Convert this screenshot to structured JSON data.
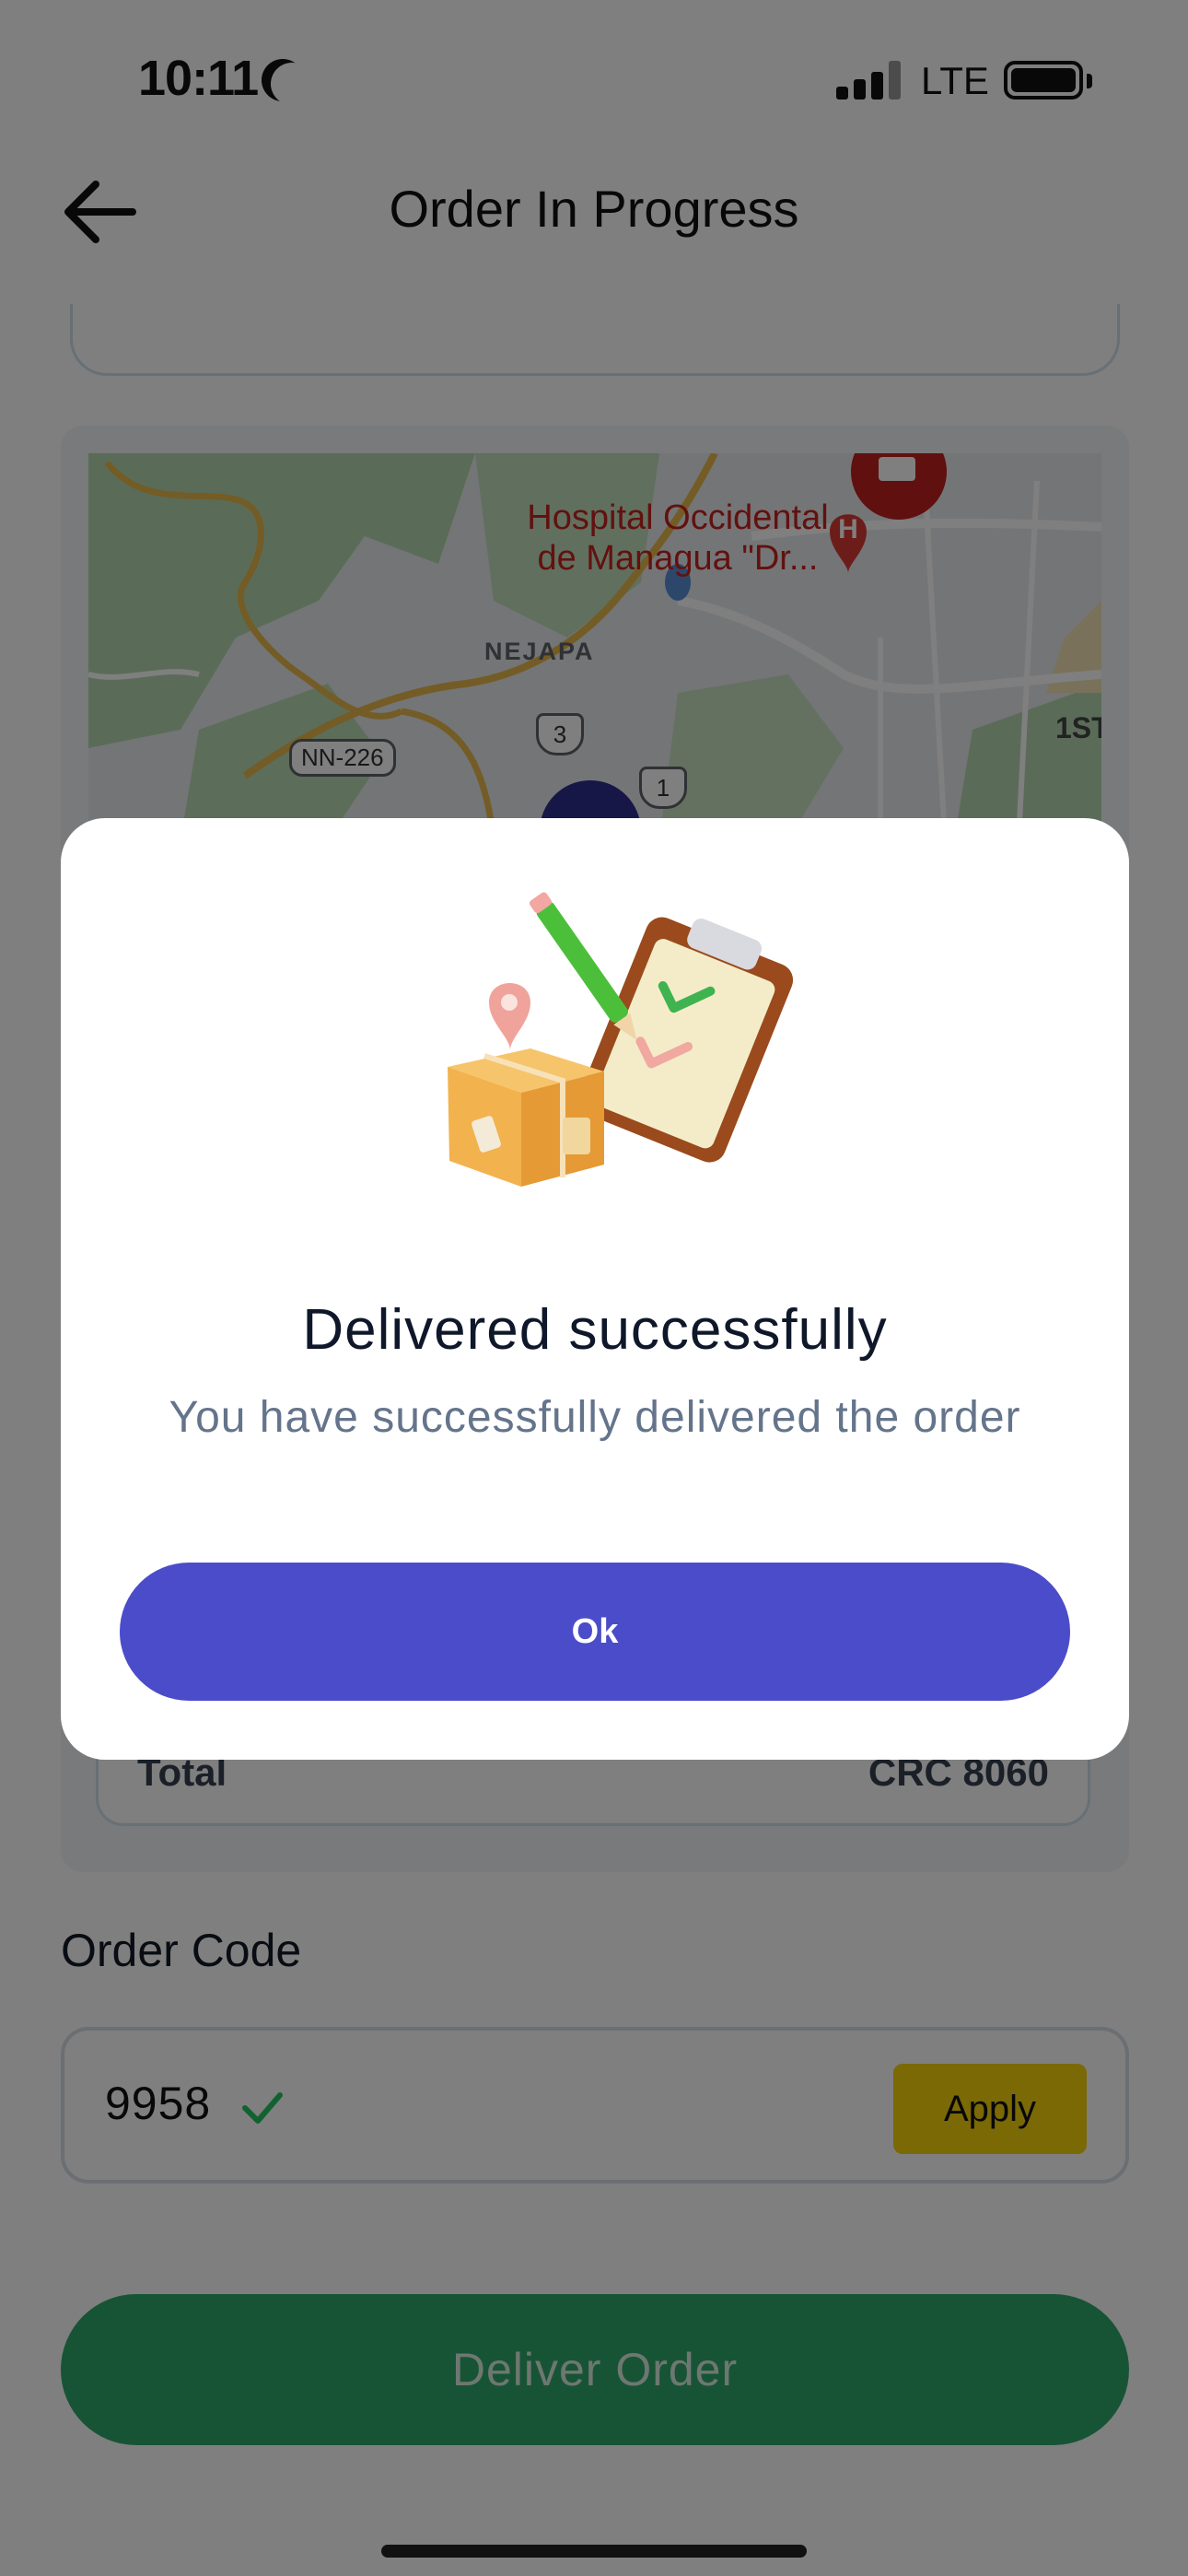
{
  "status_bar": {
    "time": "10:11",
    "network": "LTE"
  },
  "header": {
    "title": "Order In Progress"
  },
  "map": {
    "hospital_line1": "Hospital Occidental",
    "hospital_line2": "de Managua \"Dr...",
    "area_label": "NEJAPA",
    "road_nn226": "NN-226",
    "route_3": "3",
    "route_1": "1",
    "street_label": "1ST"
  },
  "order_summary": {
    "total_label": "Total",
    "total_value": "CRC 8060"
  },
  "order_code": {
    "label": "Order Code",
    "value": "9958",
    "apply_label": "Apply"
  },
  "deliver_button": {
    "label": "Deliver Order"
  },
  "modal": {
    "title": "Delivered successfully",
    "message": "You have successfully delivered the order",
    "ok_label": "Ok"
  },
  "colors": {
    "primary_purple": "#4b4cc9",
    "deliver_green": "#2ea86a",
    "apply_yellow": "#f5d20a",
    "check_green": "#22c55e"
  }
}
